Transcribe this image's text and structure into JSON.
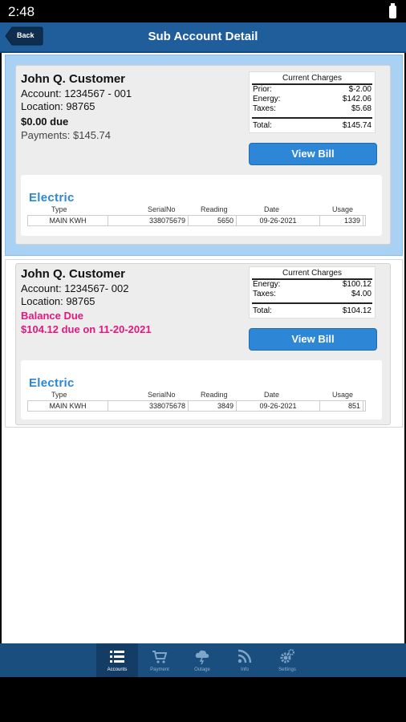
{
  "status": {
    "time": "2:48"
  },
  "header": {
    "back_label": "Back",
    "title": "Sub Account Detail"
  },
  "accounts": [
    {
      "customer": "John Q. Customer",
      "account_line": "Account:  1234567 - 001",
      "location_line": "Location:  98765",
      "due_text": "$0.00 due",
      "payments_text": "Payments: $145.74",
      "charges": {
        "title": "Current Charges",
        "rows": [
          {
            "label": "Prior:",
            "value": "$-2.00"
          },
          {
            "label": "Energy:",
            "value": "$142.06"
          },
          {
            "label": "Taxes:",
            "value": "$5.68"
          }
        ],
        "total_label": "Total:",
        "total_value": "$145.74"
      },
      "view_bill_label": "View Bill",
      "service": {
        "title": "Electric",
        "headers": [
          "Type",
          "SerialNo",
          "Reading",
          "Date",
          "Usage"
        ],
        "row": [
          "MAIN KWH",
          "338075679",
          "5650",
          "09-26-2021",
          "1339"
        ]
      }
    },
    {
      "customer": "John Q. Customer",
      "account_line": "Account:  1234567- 002",
      "location_line": "Location:  98765",
      "balance_label": "Balance Due",
      "balance_text": "$104.12 due on 11-20-2021",
      "charges": {
        "title": "Current Charges",
        "rows": [
          {
            "label": "Energy:",
            "value": "$100.12"
          },
          {
            "label": "Taxes:",
            "value": "$4.00"
          }
        ],
        "total_label": "Total:",
        "total_value": "$104.12"
      },
      "view_bill_label": "View Bill",
      "service": {
        "title": "Electric",
        "headers": [
          "Type",
          "SerialNo",
          "Reading",
          "Date",
          "Usage"
        ],
        "row": [
          "MAIN KWH",
          "338075678",
          "3849",
          "09-26-2021",
          "851"
        ]
      }
    }
  ],
  "nav": {
    "items": [
      {
        "label": "Accounts",
        "icon": "list-icon"
      },
      {
        "label": "Payment",
        "icon": "cart-icon"
      },
      {
        "label": "Outage",
        "icon": "storm-cloud-icon"
      },
      {
        "label": "Info",
        "icon": "rss-icon"
      },
      {
        "label": "Settings",
        "icon": "gear-icon"
      }
    ]
  },
  "colors": {
    "header": "#1f5d9b",
    "accent": "#2d86d6",
    "selected_account_bg": "#a8d1f3",
    "balance_due": "#e2187e"
  }
}
